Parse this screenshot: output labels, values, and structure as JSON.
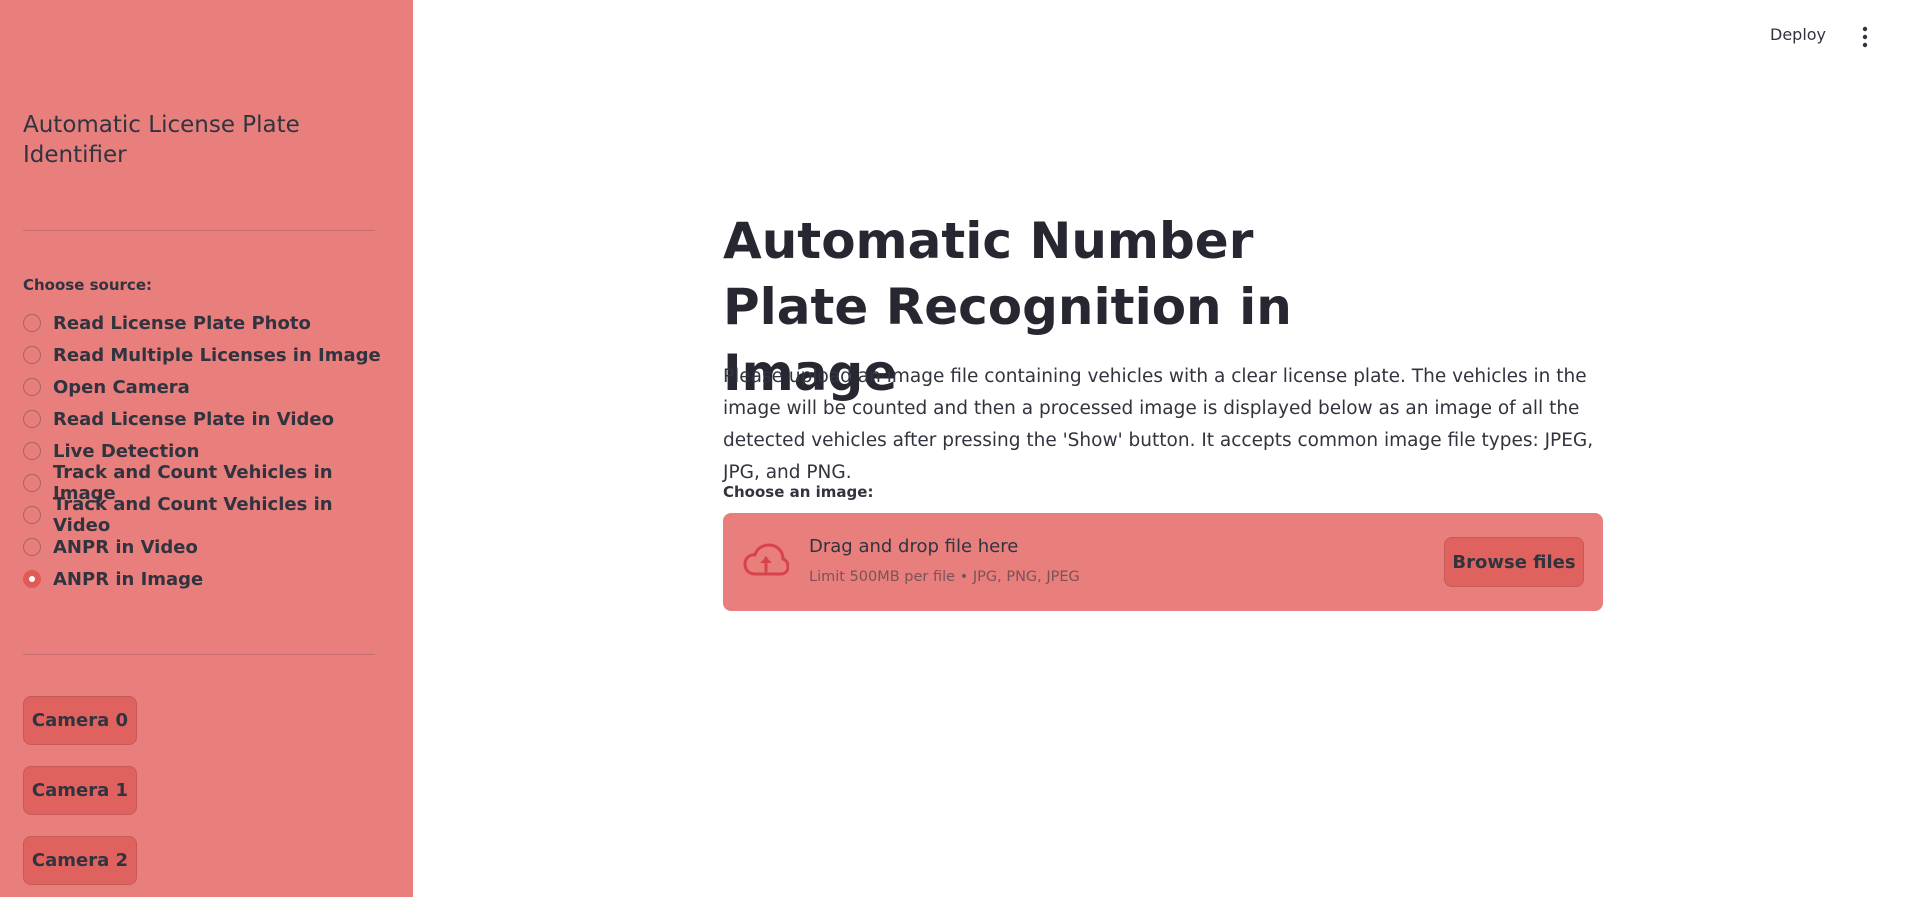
{
  "header": {
    "deploy_label": "Deploy",
    "menu_icon": "vertical-ellipsis-icon"
  },
  "sidebar": {
    "title": "Automatic License Plate Identifier",
    "source_label": "Choose source:",
    "options": [
      {
        "label": "Read License Plate Photo",
        "selected": false
      },
      {
        "label": "Read Multiple Licenses in Image",
        "selected": false
      },
      {
        "label": "Open Camera",
        "selected": false
      },
      {
        "label": "Read License Plate in Video",
        "selected": false
      },
      {
        "label": "Live Detection",
        "selected": false
      },
      {
        "label": "Track and Count Vehicles in Image",
        "selected": false
      },
      {
        "label": "Track and Count Vehicles in Video",
        "selected": false
      },
      {
        "label": "ANPR in Video",
        "selected": false
      },
      {
        "label": "ANPR in Image",
        "selected": true
      }
    ],
    "camera_buttons": [
      "Camera 0",
      "Camera 1",
      "Camera 2"
    ]
  },
  "main": {
    "title": "Automatic Number Plate Recognition in Image",
    "description": "Please upload an image file containing vehicles with a clear license plate. The vehicles in the image will be counted and then a processed image is displayed below as an image of all the detected vehicles after pressing the 'Show' button. It accepts common image file types: JPEG, JPG, and PNG.",
    "uploader": {
      "label": "Choose an image:",
      "drop_title": "Drag and drop file here",
      "limit_text": "Limit 500MB per file • JPG, PNG, JPEG",
      "browse_label": "Browse files",
      "icon": "cloud-upload-icon"
    }
  },
  "colors": {
    "sidebar_bg": "#e87f7c",
    "button_bg": "#e0625f",
    "accent": "#e05a57",
    "text": "#31333f"
  }
}
